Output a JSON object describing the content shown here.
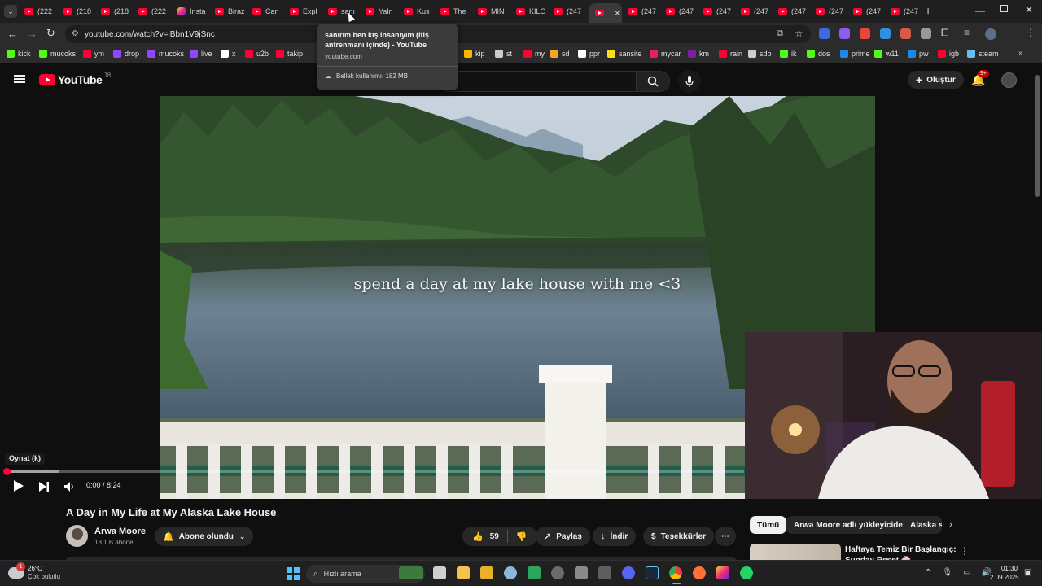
{
  "browser": {
    "tabs": [
      {
        "label": "(222",
        "type": "yt"
      },
      {
        "label": "(218",
        "type": "yt"
      },
      {
        "label": "(218",
        "type": "yt"
      },
      {
        "label": "(222",
        "type": "yt"
      },
      {
        "label": "Insta",
        "type": "ig"
      },
      {
        "label": "Biraz",
        "type": "yt"
      },
      {
        "label": "Can",
        "type": "yt"
      },
      {
        "label": "Expl",
        "type": "yt"
      },
      {
        "label": "sanı",
        "type": "yt"
      },
      {
        "label": "Yaln",
        "type": "yt"
      },
      {
        "label": "Kus",
        "type": "yt"
      },
      {
        "label": "The",
        "type": "yt"
      },
      {
        "label": "MIN",
        "type": "yt"
      },
      {
        "label": "KILO",
        "type": "yt"
      },
      {
        "label": "(247",
        "type": "yt"
      },
      {
        "label": "",
        "type": "yt",
        "active": true
      },
      {
        "label": "(247",
        "type": "yt"
      },
      {
        "label": "(247",
        "type": "yt"
      },
      {
        "label": "(247",
        "type": "yt"
      },
      {
        "label": "(247",
        "type": "yt"
      },
      {
        "label": "(247",
        "type": "yt"
      },
      {
        "label": "(247",
        "type": "yt"
      },
      {
        "label": "(247",
        "type": "yt"
      },
      {
        "label": "(247",
        "type": "yt"
      }
    ],
    "url": "youtube.com/watch?v=iBbn1V9jSnc",
    "tooltip": {
      "title": "sanırım ben kış insanıyım (itiş antrenmanı içinde) - YouTube",
      "domain": "youtube.com",
      "memory": "Bellek kullanımı: 182 MB"
    },
    "bookmarks": [
      {
        "label": "kick",
        "color": "#53fc18"
      },
      {
        "label": "mucoks",
        "color": "#53fc18"
      },
      {
        "label": "ym",
        "color": "#ff0033"
      },
      {
        "label": "drop",
        "color": "#9146ff"
      },
      {
        "label": "mucoks",
        "color": "#9146ff"
      },
      {
        "label": "live",
        "color": "#9146ff"
      },
      {
        "label": "x",
        "color": "#ffffff"
      },
      {
        "label": "u2b",
        "color": "#ff0033"
      },
      {
        "label": "takip",
        "color": "#ff0033"
      },
      {
        "label": "kip",
        "color": "#ffb400"
      },
      {
        "label": "st",
        "color": "#cccccc"
      },
      {
        "label": "my",
        "color": "#ff0033"
      },
      {
        "label": "sd",
        "color": "#f5a623"
      },
      {
        "label": "ppr",
        "color": "#ffffff"
      },
      {
        "label": "sansite",
        "color": "#f7e018"
      },
      {
        "label": "mycar",
        "color": "#e91e63"
      },
      {
        "label": "km",
        "color": "#7b1fa2"
      },
      {
        "label": "rain",
        "color": "#ff0033"
      },
      {
        "label": "sdb",
        "color": "#cccccc"
      },
      {
        "label": "ik",
        "color": "#53fc18"
      },
      {
        "label": "dos",
        "color": "#53fc18"
      },
      {
        "label": "prime",
        "color": "#1e88e5"
      },
      {
        "label": "w11",
        "color": "#53fc18"
      },
      {
        "label": "pw",
        "color": "#1e88e5"
      },
      {
        "label": "igb",
        "color": "#ff0033"
      },
      {
        "label": "steam",
        "color": "#66c0f4"
      }
    ]
  },
  "youtube": {
    "logo": "YouTube",
    "region": "TR",
    "create_label": "Oluştur",
    "notif_count": "9+",
    "player": {
      "overlay_text": "spend a day at my lake house with me <3",
      "play_tooltip": "Oynat (k)",
      "time": "0:00 / 8:24",
      "progress": 0.0
    },
    "video": {
      "title": "A Day in My Life at My Alaska Lake House",
      "channel": "Arwa Moore",
      "subscribers": "13,1 B abone",
      "subscribed_label": "Abone olundu",
      "likes": "59",
      "share_label": "Paylaş",
      "download_label": "İndir",
      "thanks_label": "Teşekkürler"
    },
    "chips": [
      "Tümü",
      "Arwa Moore adlı yükleyiciden",
      "Alaska s"
    ],
    "related": {
      "title_line1": "Haftaya Temiz Bir Başlangıç:",
      "title_line2": "Sunday Reset 🧼"
    }
  },
  "taskbar": {
    "weather_temp": "26°C",
    "weather_desc": "Çok bulutlu",
    "weather_badge": "1",
    "search_placeholder": "Hızlı arama",
    "time": "01:30",
    "date": "2.09.2025"
  }
}
